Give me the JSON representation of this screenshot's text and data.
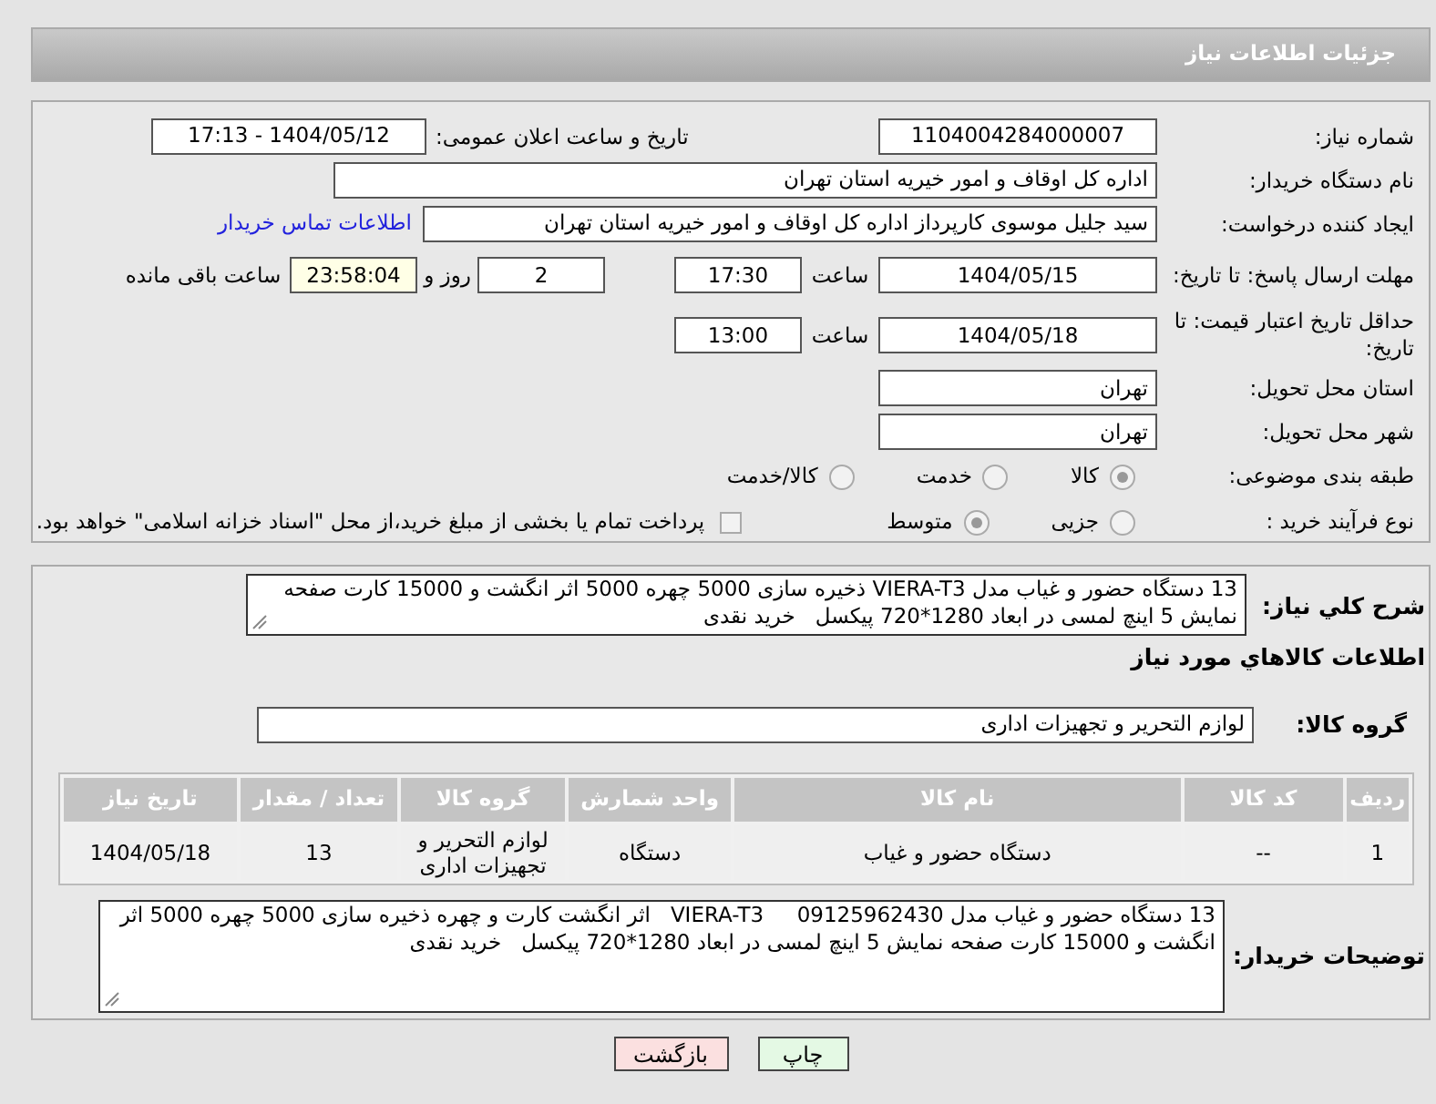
{
  "page_title": "جزئیات اطلاعات نیاز",
  "need_number": {
    "label": "شماره نیاز:",
    "value": "1104004284000007"
  },
  "announce": {
    "label": "تاریخ و ساعت اعلان عمومی:",
    "value": "1404/05/12 - 17:13"
  },
  "buyer_org": {
    "label": "نام دستگاه خریدار:",
    "value": "اداره کل اوقاف و امور خیریه استان تهران"
  },
  "requester": {
    "label": "ایجاد کننده درخواست:",
    "value": "سید جلیل موسوی کارپرداز اداره کل اوقاف و امور خیریه استان تهران",
    "contact_link": "اطلاعات تماس خریدار"
  },
  "deadline": {
    "label": "مهلت ارسال پاسخ: تا تاریخ:",
    "date": "1404/05/15",
    "time_label": "ساعت",
    "time": "17:30",
    "days": "2",
    "days_label": "روز و",
    "remaining": "23:58:04",
    "remaining_label": "ساعت باقی مانده"
  },
  "validity": {
    "label": "حداقل تاریخ اعتبار قیمت: تا تاریخ:",
    "date": "1404/05/18",
    "time_label": "ساعت",
    "time": "13:00"
  },
  "province": {
    "label": "استان محل تحویل:",
    "value": "تهران"
  },
  "city": {
    "label": "شهر محل تحویل:",
    "value": "تهران"
  },
  "category": {
    "label": "طبقه بندی موضوعی:",
    "options": [
      {
        "label": "کالا",
        "selected": true
      },
      {
        "label": "خدمت",
        "selected": false
      },
      {
        "label": "کالا/خدمت",
        "selected": false
      }
    ]
  },
  "process": {
    "label": "نوع فرآیند خرید :",
    "options": [
      {
        "label": "جزیی",
        "selected": false
      },
      {
        "label": "متوسط",
        "selected": true
      }
    ],
    "payment": {
      "label": "پرداخت تمام یا بخشی از مبلغ خرید،از محل \"اسناد خزانه اسلامی\" خواهد بود.",
      "checked": false
    }
  },
  "description": {
    "label": "شرح کلي نياز:",
    "value": "13 دستگاه حضور و غیاب مدل VIERA-T3 ذخیره سازی 5000 چهره 5000 اثر انگشت و 15000 کارت صفحه نمایش 5 اینچ لمسی در ابعاد 1280*720 پیکسل   خرید نقدی"
  },
  "items_heading": "اطلاعات کالاهاي مورد نياز",
  "group": {
    "label": "گروه کالا:",
    "value": "لوازم التحریر و تجهیزات اداری"
  },
  "table": {
    "columns": [
      "ردیف",
      "کد کالا",
      "نام کالا",
      "واحد شمارش",
      "گروه کالا",
      "تعداد / مقدار",
      "تاریخ نیاز"
    ],
    "rows": [
      [
        "1",
        "--",
        "دستگاه حضور و غیاب",
        "دستگاه",
        "لوازم التحریر و تجهیزات اداری",
        "13",
        "1404/05/18"
      ]
    ]
  },
  "buyer_notes": {
    "label": "توضیحات خریدار:",
    "value": "13 دستگاه حضور و غیاب مدل 09125962430     VIERA-T3   اثر انگشت کارت و چهره ذخیره سازی 5000 چهره 5000 اثر انگشت و 15000 کارت صفحه نمایش 5 اینچ لمسی در ابعاد 1280*720 پیکسل   خرید نقدی"
  },
  "buttons": [
    {
      "label": "چاپ",
      "kind": "print"
    },
    {
      "label": "بازگشت",
      "kind": "back"
    }
  ]
}
